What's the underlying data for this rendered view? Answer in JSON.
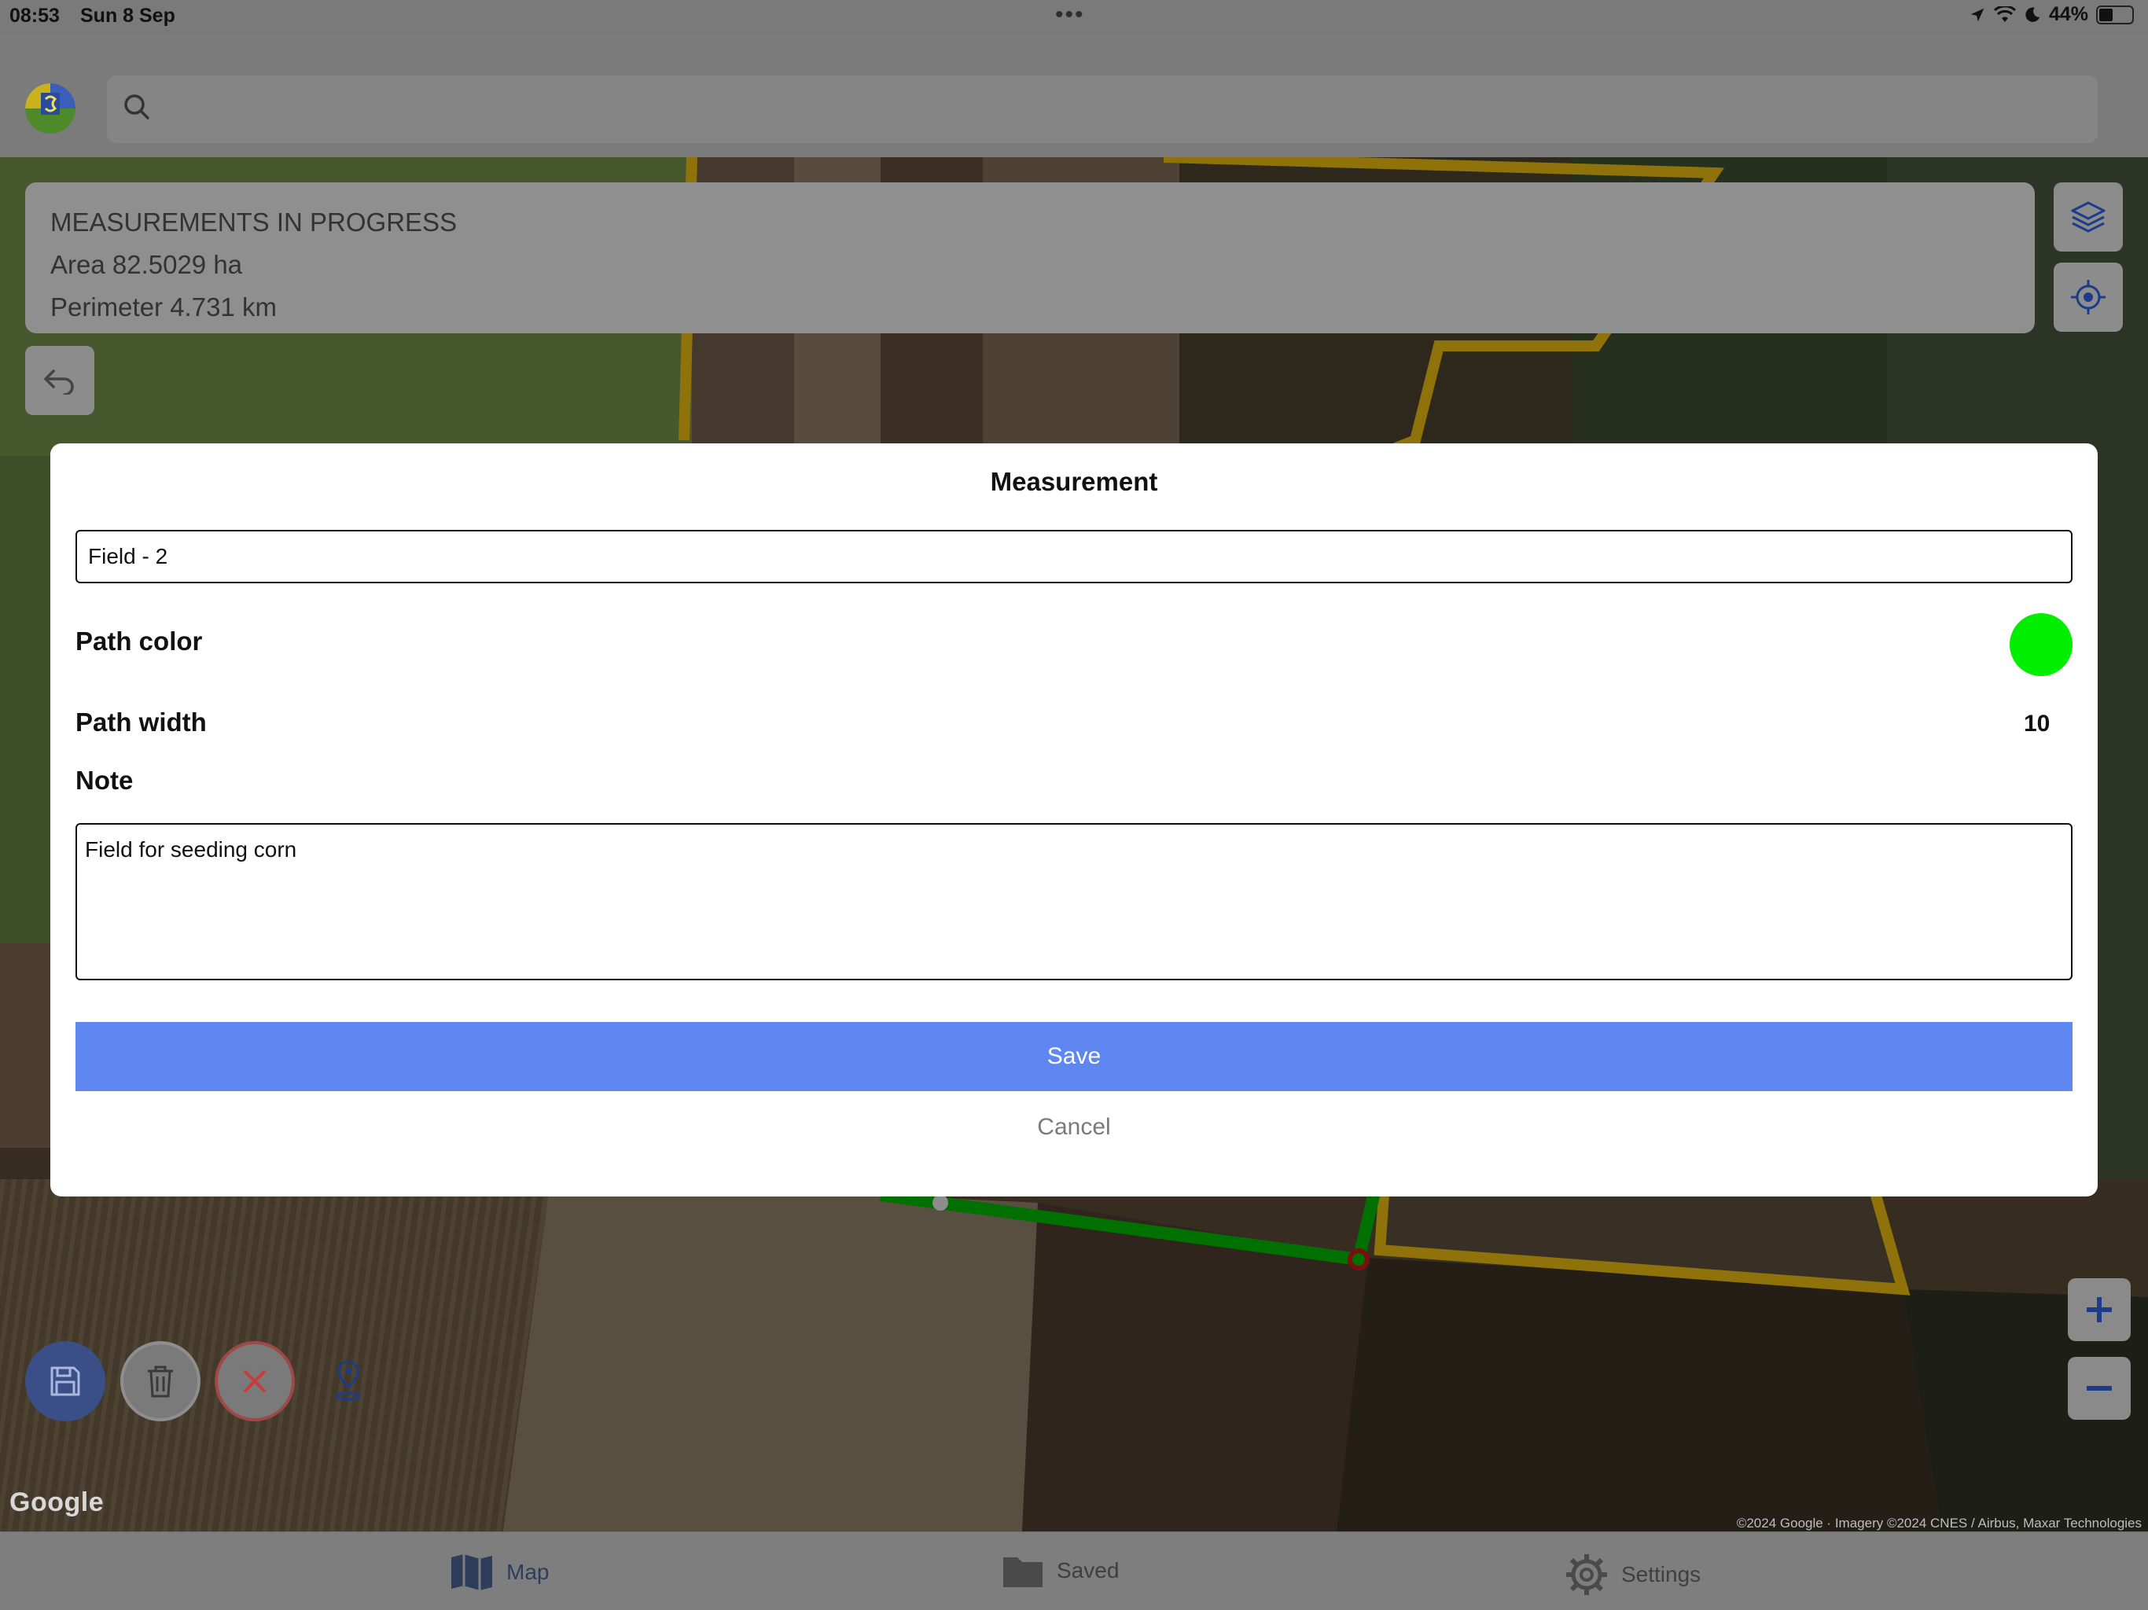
{
  "status_bar": {
    "time": "08:53",
    "date": "Sun 8 Sep",
    "dots": "•••",
    "battery": "44%",
    "battery_level": 0.44
  },
  "search": {
    "value": "",
    "placeholder": ""
  },
  "measurement_panel": {
    "title": "MEASUREMENTS IN PROGRESS",
    "area": "Area 82.5029 ha",
    "perimeter": "Perimeter 4.731 km"
  },
  "modal": {
    "title": "Measurement",
    "name_value": "Field - 2",
    "path_color_label": "Path color",
    "path_color_value": "#00ee00",
    "path_width_label": "Path width",
    "path_width_value": "10",
    "note_label": "Note",
    "note_value": "Field for seeding corn",
    "save_label": "Save",
    "cancel_label": "Cancel"
  },
  "map": {
    "google_logo": "Google",
    "attribution": "©2024 Google · Imagery ©2024 CNES / Airbus, Maxar Technologies",
    "field_outline_color": "#e2b312",
    "measured_path_color": "#00b000"
  },
  "tabs": [
    {
      "label": "Map",
      "icon": "map-icon"
    },
    {
      "label": "Saved",
      "icon": "folder-icon"
    },
    {
      "label": "Settings",
      "icon": "gear-icon"
    }
  ],
  "colors": {
    "accent": "#5f87f2",
    "fab_save": "#3a4e88",
    "cancel_red": "#c83c3c"
  }
}
